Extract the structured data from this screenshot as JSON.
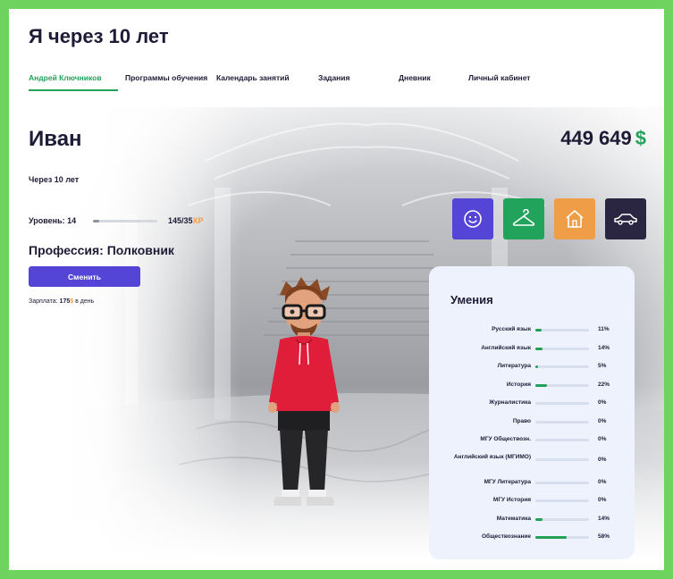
{
  "app": {
    "title": "Я через 10 лет"
  },
  "tabs": [
    {
      "label": "Андрей Ключников",
      "active": true
    },
    {
      "label": "Программы обучения",
      "active": false
    },
    {
      "label": "Календарь занятий",
      "active": false
    },
    {
      "label": "Задания",
      "active": false
    },
    {
      "label": "Дневник",
      "active": false
    },
    {
      "label": "Личный кабинет",
      "active": false
    }
  ],
  "profile": {
    "name": "Иван",
    "balance": "449 649",
    "currency": "$",
    "subtitle": "Через 10 лет",
    "level_label": "Уровень: 14",
    "xp": "145/35",
    "xp_unit": "XP",
    "level_progress": 0.1,
    "profession": "Профессия: Полковник",
    "change_label": "Сменить",
    "salary_prefix": "Зарплата: ",
    "salary_value": "175",
    "salary_currency": "$",
    "salary_suffix": " в день"
  },
  "actions": [
    {
      "name": "mood",
      "icon": "smile-icon",
      "color": "#5545d6"
    },
    {
      "name": "clothes",
      "icon": "hanger-icon",
      "color": "#21a35b"
    },
    {
      "name": "home",
      "icon": "house-icon",
      "color": "#ef9d47"
    },
    {
      "name": "car",
      "icon": "car-icon",
      "color": "#2a2540"
    }
  ],
  "skills": {
    "title": "Умения",
    "items": [
      {
        "name": "Русский язык",
        "value": "11%",
        "pct": 11
      },
      {
        "name": "Английский язык",
        "value": "14%",
        "pct": 14
      },
      {
        "name": "Литература",
        "value": "5%",
        "pct": 5
      },
      {
        "name": "История",
        "value": "22%",
        "pct": 22
      },
      {
        "name": "Журналистика",
        "value": "0%",
        "pct": 0
      },
      {
        "name": "Право",
        "value": "0%",
        "pct": 0
      },
      {
        "name": "МГУ Обществозн.",
        "value": "0%",
        "pct": 0
      },
      {
        "name": "Английский язык (МГИМО)",
        "value": "0%",
        "pct": 0
      },
      {
        "name": "МГУ Литература",
        "value": "0%",
        "pct": 0
      },
      {
        "name": "МГУ История",
        "value": "0%",
        "pct": 0
      },
      {
        "name": "Математика",
        "value": "14%",
        "pct": 14
      },
      {
        "name": "Обществознание",
        "value": "58%",
        "pct": 58
      }
    ]
  }
}
